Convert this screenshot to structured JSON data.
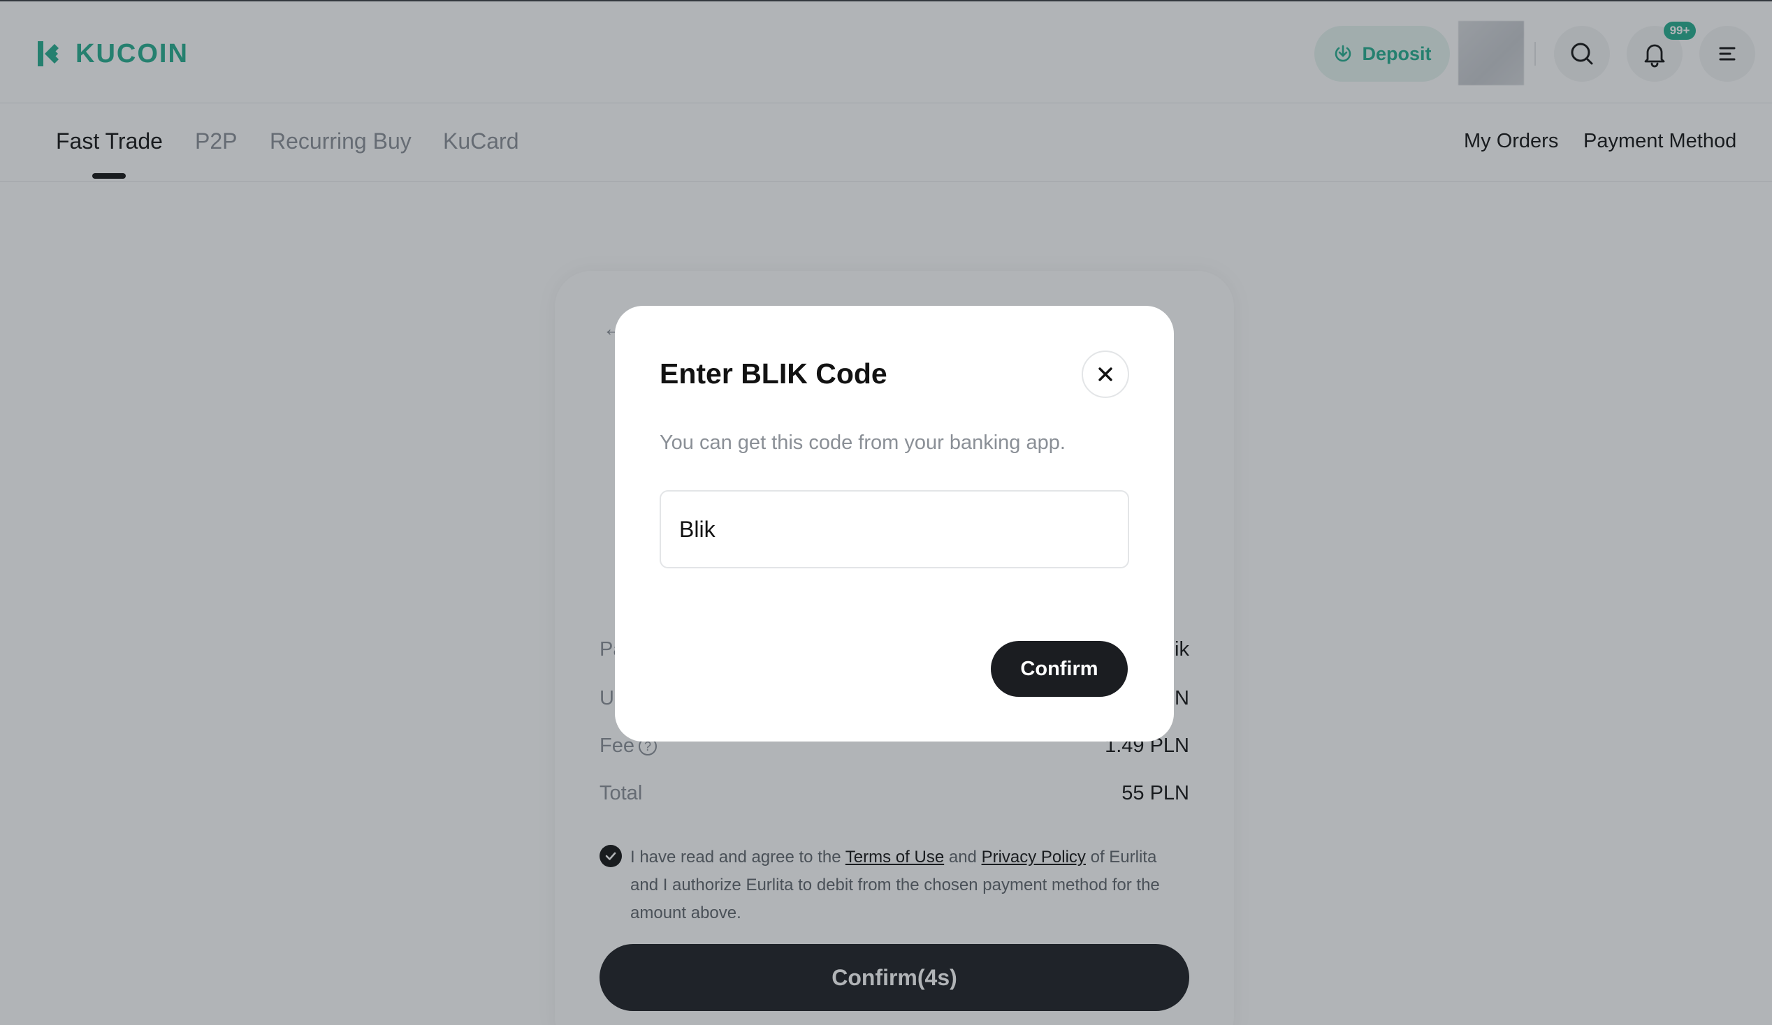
{
  "brand": {
    "name": "KUCOIN",
    "color": "#24ae8f",
    "logo_icon": "kucoin-logo-icon"
  },
  "header": {
    "deposit_label": "Deposit",
    "deposit_icon": "download-circle-icon",
    "notification_badge": "99+",
    "icons": [
      "search-icon",
      "bell-icon",
      "menu-icon"
    ]
  },
  "tabs": [
    {
      "label": "Fast Trade",
      "active": true
    },
    {
      "label": "P2P",
      "active": false
    },
    {
      "label": "Recurring Buy",
      "active": false
    },
    {
      "label": "KuCard",
      "active": false
    }
  ],
  "right_links": {
    "orders": "My Orders",
    "payment": "Payment Method"
  },
  "summary": {
    "rows": [
      {
        "key": "Pa",
        "value": "ik"
      },
      {
        "key": "U",
        "value": "N"
      },
      {
        "key": "Fee",
        "value": "1.49 PLN"
      },
      {
        "key": "Total",
        "value": "55 PLN"
      }
    ],
    "agree_prefix": "I have read and agree to the",
    "terms_link": "Terms of Use",
    "and_word": "and",
    "privacy_link": "Privacy Policy",
    "agree_suffix": "of Eurlita and I authorize Eurlita to debit from the chosen payment method for the amount above.",
    "confirm_label": "Confirm(4s)"
  },
  "modal": {
    "title": "Enter BLIK Code",
    "subtitle": "You can get this code from your banking app.",
    "input_value": "Blik",
    "confirm_label": "Confirm",
    "close_icon": "close-icon"
  }
}
